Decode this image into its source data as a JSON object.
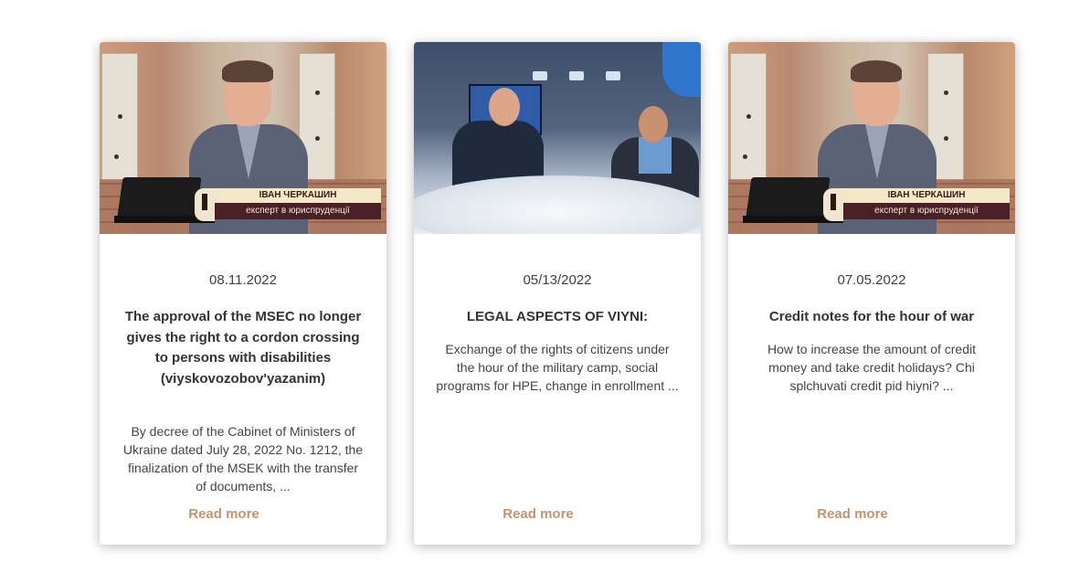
{
  "cards": [
    {
      "date": "08.11.2022",
      "title": "The approval of the MSEC no longer gives the right to a cordon crossing to persons with disabilities (viyskovozobov'yazanim)",
      "excerpt": "By decree of the Cabinet of Ministers of Ukraine dated July 28, 2022 No. 1212, the finalization of the MSEK with the transfer of documents, ...",
      "read_more": "Read more",
      "caption_name": "ІВАН ЧЕРКАШИН",
      "caption_role": "експерт в юриспруденції"
    },
    {
      "date": "05/13/2022",
      "title": "LEGAL ASPECTS OF VIYNI:",
      "excerpt": "Exchange of the rights of citizens under the hour of the military camp, social programs for HPE, change in enrollment ...",
      "read_more": "Read more"
    },
    {
      "date": "07.05.2022",
      "title": "Credit notes for the hour of war",
      "excerpt": "How to increase the amount of credit money and take credit holidays? Chi splchuvati credit pid hiyni? ...",
      "read_more": "Read more",
      "caption_name": "ІВАН ЧЕРКАШИН",
      "caption_role": "експерт в юриспруденції"
    }
  ],
  "colors": {
    "read_more": "#c39470",
    "text": "#333333"
  }
}
